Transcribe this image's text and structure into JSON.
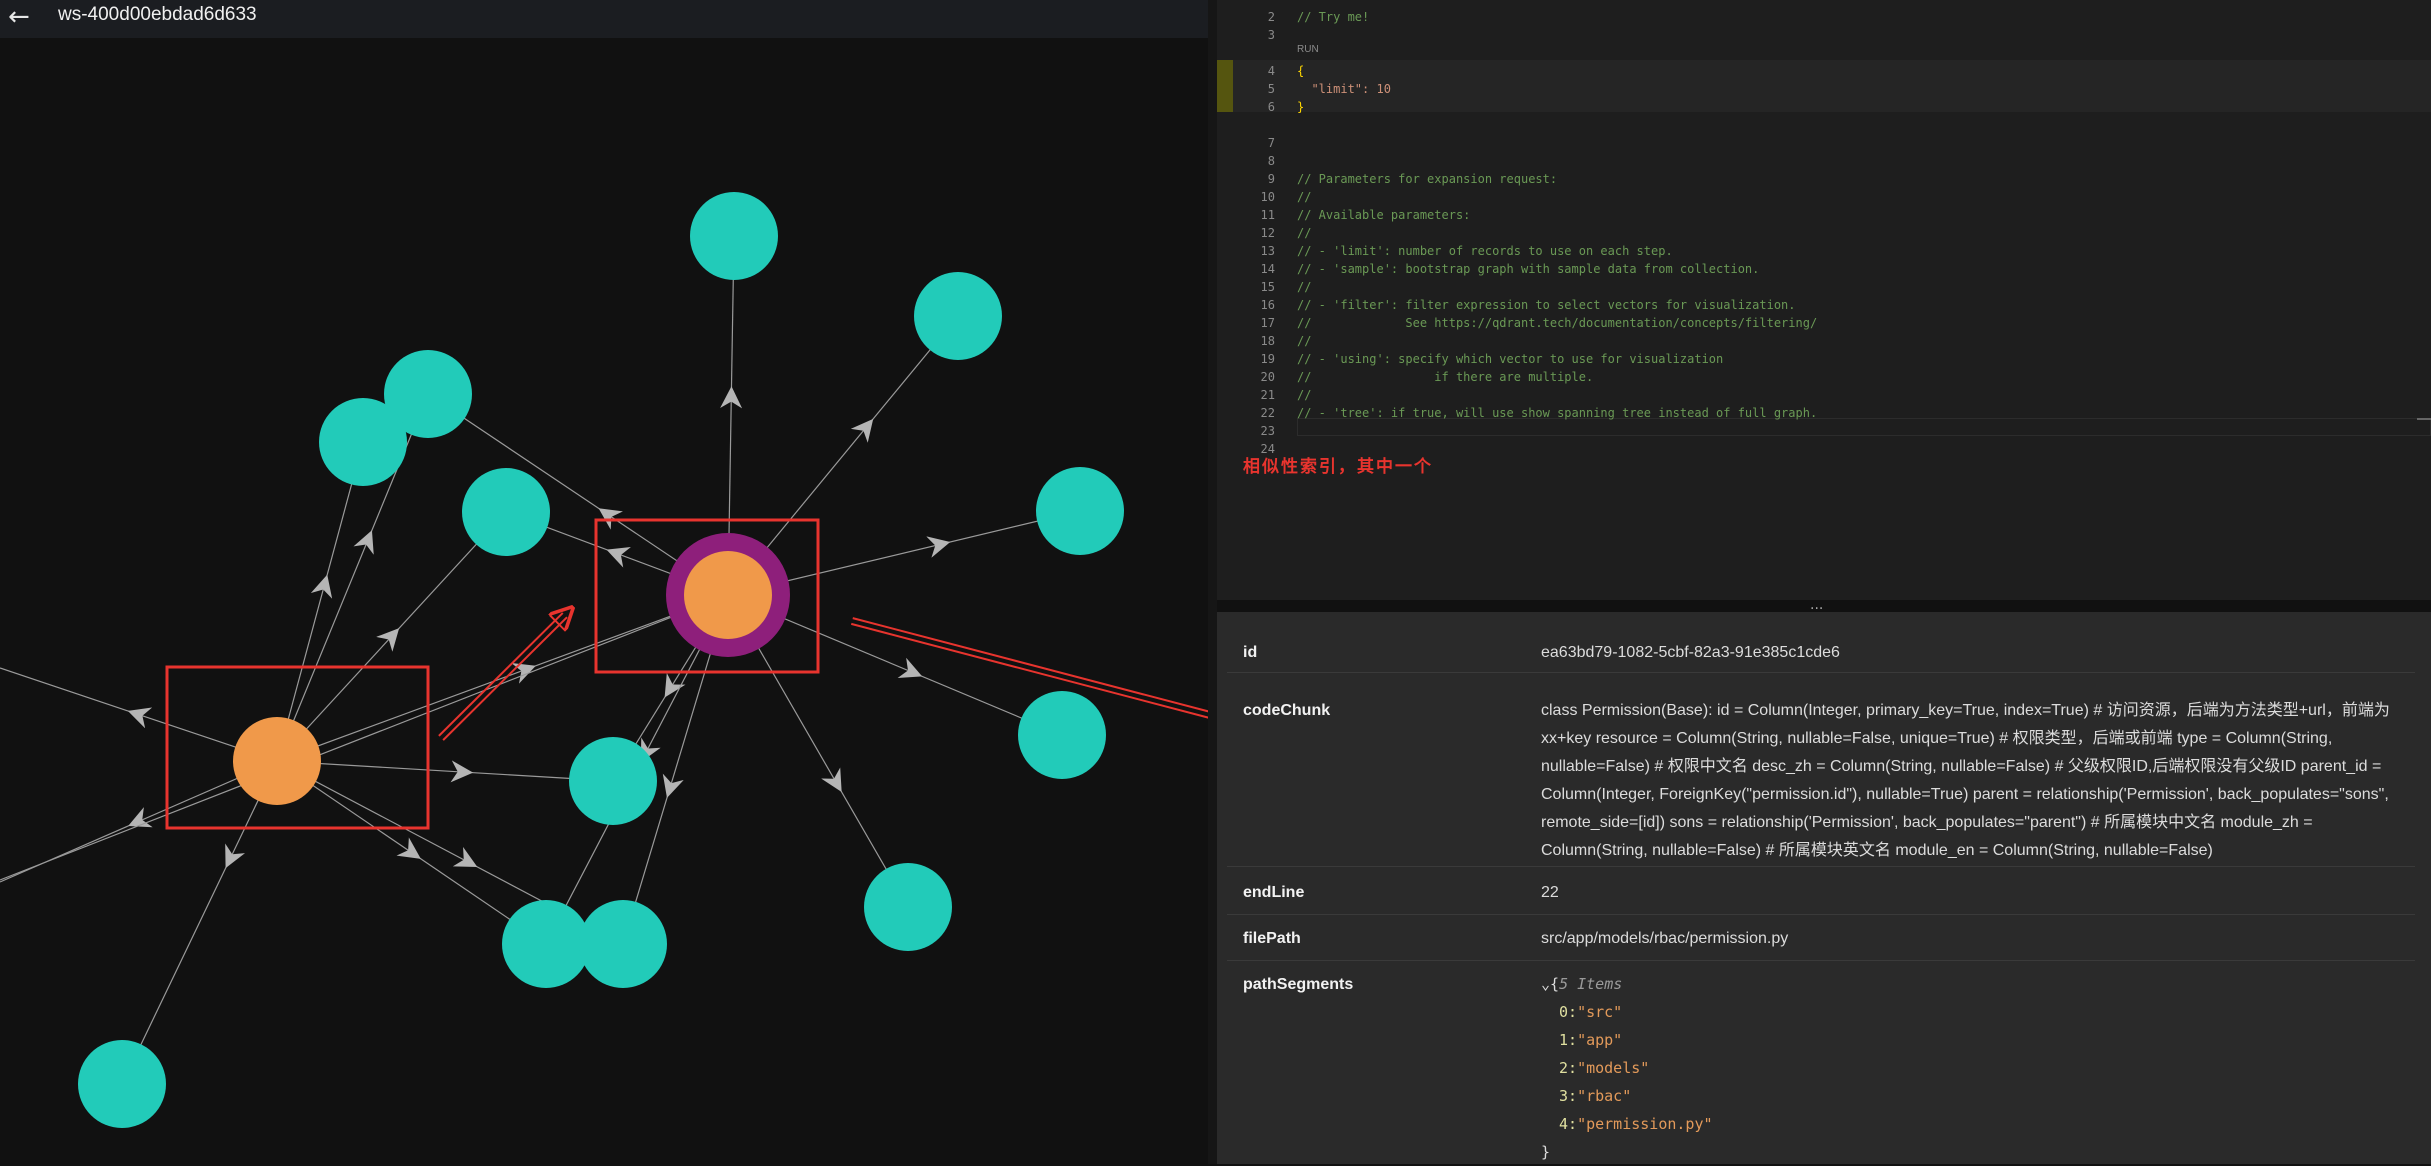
{
  "header": {
    "back_icon": "arrow-left-icon",
    "title": "ws-400d00ebdad6d633"
  },
  "editor": {
    "run_label": "RUN",
    "lines": [
      {
        "n": "2",
        "t": "// Try me!"
      },
      {
        "n": "3",
        "t": ""
      },
      {
        "n": "4",
        "t": "{"
      },
      {
        "n": "5",
        "t": "  \"limit\": 10"
      },
      {
        "n": "6",
        "t": "}"
      },
      {
        "n": "7",
        "t": ""
      },
      {
        "n": "8",
        "t": ""
      },
      {
        "n": "9",
        "t": "// Parameters for expansion request:"
      },
      {
        "n": "10",
        "t": "//"
      },
      {
        "n": "11",
        "t": "// Available parameters:"
      },
      {
        "n": "12",
        "t": "//"
      },
      {
        "n": "13",
        "t": "// - 'limit': number of records to use on each step."
      },
      {
        "n": "14",
        "t": "// - 'sample': bootstrap graph with sample data from collection."
      },
      {
        "n": "15",
        "t": "//"
      },
      {
        "n": "16",
        "t": "// - 'filter': filter expression to select vectors for visualization."
      },
      {
        "n": "17",
        "t": "//             See https://qdrant.tech/documentation/concepts/filtering/"
      },
      {
        "n": "18",
        "t": "//"
      },
      {
        "n": "19",
        "t": "// - 'using': specify which vector to use for visualization"
      },
      {
        "n": "20",
        "t": "//                 if there are multiple."
      },
      {
        "n": "21",
        "t": "//"
      },
      {
        "n": "22",
        "t": "// - 'tree': if true, will use show spanning tree instead of full graph."
      },
      {
        "n": "23",
        "t": ""
      },
      {
        "n": "24",
        "t": ""
      }
    ]
  },
  "annotation": {
    "text": "相似性索引，其中一个",
    "color": "#e8342e"
  },
  "details": {
    "handle": "...",
    "id_label": "id",
    "id_value": "ea63bd79-1082-5cbf-82a3-91e385c1cde6",
    "codeChunk_label": "codeChunk",
    "codeChunk_value": "class Permission(Base): id = Column(Integer, primary_key=True, index=True) # 访问资源，后端为方法类型+url，前端为xx+key resource = Column(String, nullable=False, unique=True) # 权限类型，后端或前端 type = Column(String, nullable=False) # 权限中文名 desc_zh = Column(String, nullable=False) # 父级权限ID,后端权限没有父级ID parent_id = Column(Integer, ForeignKey(\"permission.id\"), nullable=True) parent = relationship('Permission', back_populates=\"sons\", remote_side=[id]) sons = relationship('Permission', back_populates=\"parent\") # 所属模块中文名 module_zh = Column(String, nullable=False) # 所属模块英文名 module_en = Column(String, nullable=False)",
    "endLine_label": "endLine",
    "endLine_value": "22",
    "filePath_label": "filePath",
    "filePath_value": "src/app/models/rbac/permission.py",
    "pathSegments_label": "pathSegments",
    "pathSegments": {
      "toggle": "⌄{",
      "count": "5 Items",
      "items": [
        {
          "i": "0:",
          "v": "\"src\""
        },
        {
          "i": "1:",
          "v": "\"app\""
        },
        {
          "i": "2:",
          "v": "\"models\""
        },
        {
          "i": "3:",
          "v": "\"rbac\""
        },
        {
          "i": "4:",
          "v": "\"permission.py\""
        }
      ],
      "close": "}"
    }
  },
  "graph": {
    "colors": {
      "node": "#22cbb9",
      "center": "#f0994a",
      "ring": "#8e1f7b",
      "edge": "#9a9a9a",
      "highlight": "#e8342e"
    },
    "node_count": 19,
    "selected_node": "center-node-main"
  }
}
